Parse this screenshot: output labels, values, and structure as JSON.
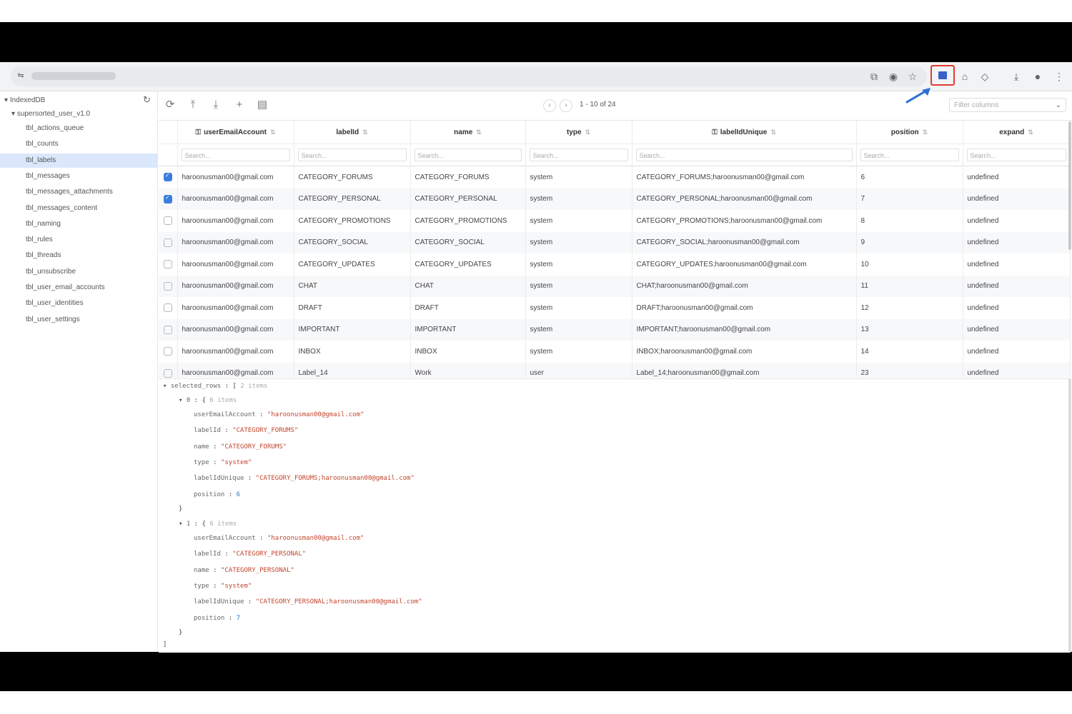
{
  "browser": {
    "site_icon": "tune-icon",
    "toolbar_icons": [
      "screen-cast-icon",
      "eye-off-icon",
      "star-icon",
      "extension-square-icon",
      "extension-badge-icon",
      "puzzle-icon",
      "download-icon",
      "profile-icon",
      "more-vert-icon"
    ],
    "highlight_color": "#e53935",
    "arrow_color": "#2a6fd6"
  },
  "sidebar": {
    "database": "IndexedDB",
    "store": "supersorted_user_v1.0",
    "tables": [
      "tbl_actions_queue",
      "tbl_counts",
      "tbl_labels",
      "tbl_messages",
      "tbl_messages_attachments",
      "tbl_messages_content",
      "tbl_naming",
      "tbl_rules",
      "tbl_threads",
      "tbl_unsubscribe",
      "tbl_user_email_accounts",
      "tbl_user_identities",
      "tbl_user_settings"
    ],
    "selected_index": 2
  },
  "toolbar": {
    "pager_text": "1 - 10 of 24",
    "filter_placeholder": "Filter columns"
  },
  "table": {
    "columns": [
      "userEmailAccount",
      "labelId",
      "name",
      "type",
      "labelIdUnique",
      "position",
      "expand"
    ],
    "search_placeholder": "Search...",
    "rows": [
      {
        "checked": true,
        "cells": [
          "haroonusman00@gmail.com",
          "CATEGORY_FORUMS",
          "CATEGORY_FORUMS",
          "system",
          "CATEGORY_FORUMS;haroonusman00@gmail.com",
          "6",
          "undefined"
        ]
      },
      {
        "checked": true,
        "cells": [
          "haroonusman00@gmail.com",
          "CATEGORY_PERSONAL",
          "CATEGORY_PERSONAL",
          "system",
          "CATEGORY_PERSONAL;haroonusman00@gmail.com",
          "7",
          "undefined"
        ]
      },
      {
        "checked": false,
        "cells": [
          "haroonusman00@gmail.com",
          "CATEGORY_PROMOTIONS",
          "CATEGORY_PROMOTIONS",
          "system",
          "CATEGORY_PROMOTIONS;haroonusman00@gmail.com",
          "8",
          "undefined"
        ]
      },
      {
        "checked": false,
        "cells": [
          "haroonusman00@gmail.com",
          "CATEGORY_SOCIAL",
          "CATEGORY_SOCIAL",
          "system",
          "CATEGORY_SOCIAL;haroonusman00@gmail.com",
          "9",
          "undefined"
        ]
      },
      {
        "checked": false,
        "cells": [
          "haroonusman00@gmail.com",
          "CATEGORY_UPDATES",
          "CATEGORY_UPDATES",
          "system",
          "CATEGORY_UPDATES;haroonusman00@gmail.com",
          "10",
          "undefined"
        ]
      },
      {
        "checked": false,
        "cells": [
          "haroonusman00@gmail.com",
          "CHAT",
          "CHAT",
          "system",
          "CHAT;haroonusman00@gmail.com",
          "11",
          "undefined"
        ]
      },
      {
        "checked": false,
        "cells": [
          "haroonusman00@gmail.com",
          "DRAFT",
          "DRAFT",
          "system",
          "DRAFT;haroonusman00@gmail.com",
          "12",
          "undefined"
        ]
      },
      {
        "checked": false,
        "cells": [
          "haroonusman00@gmail.com",
          "IMPORTANT",
          "IMPORTANT",
          "system",
          "IMPORTANT;haroonusman00@gmail.com",
          "13",
          "undefined"
        ]
      },
      {
        "checked": false,
        "cells": [
          "haroonusman00@gmail.com",
          "INBOX",
          "INBOX",
          "system",
          "INBOX;haroonusman00@gmail.com",
          "14",
          "undefined"
        ]
      },
      {
        "checked": false,
        "cells": [
          "haroonusman00@gmail.com",
          "Label_14",
          "Work",
          "user",
          "Label_14;haroonusman00@gmail.com",
          "23",
          "undefined"
        ]
      }
    ]
  },
  "json_view": {
    "root_key": "selected_rows",
    "root_count": "2 items",
    "item_count": "6 items",
    "items": [
      {
        "index": "0",
        "userEmailAccount": "\"haroonusman00@gmail.com\"",
        "labelId": "\"CATEGORY_FORUMS\"",
        "name": "\"CATEGORY_FORUMS\"",
        "type": "\"system\"",
        "labelIdUnique": "\"CATEGORY_FORUMS;haroonusman00@gmail.com\"",
        "position": "6"
      },
      {
        "index": "1",
        "userEmailAccount": "\"haroonusman00@gmail.com\"",
        "labelId": "\"CATEGORY_PERSONAL\"",
        "name": "\"CATEGORY_PERSONAL\"",
        "type": "\"system\"",
        "labelIdUnique": "\"CATEGORY_PERSONAL;haroonusman00@gmail.com\"",
        "position": "7"
      }
    ]
  }
}
